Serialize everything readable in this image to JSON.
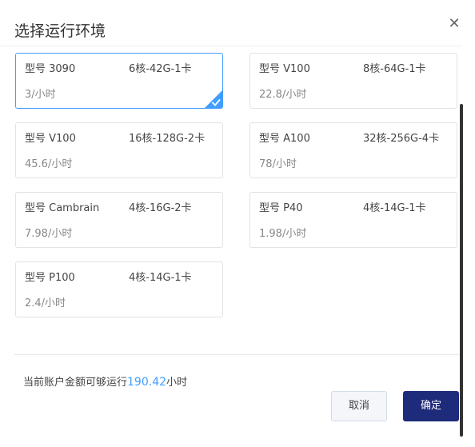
{
  "dialog": {
    "title": "选择运行环境",
    "close_icon": "close-icon"
  },
  "environments": [
    {
      "model": "型号 3090",
      "spec": "6核-42G-1卡",
      "price": "3/小时",
      "selected": true
    },
    {
      "model": "型号 V100",
      "spec": "8核-64G-1卡",
      "price": "22.8/小时",
      "selected": false
    },
    {
      "model": "型号 V100",
      "spec": "16核-128G-2卡",
      "price": "45.6/小时",
      "selected": false
    },
    {
      "model": "型号 A100",
      "spec": "32核-256G-4卡",
      "price": "78/小时",
      "selected": false
    },
    {
      "model": "型号 Cambrain",
      "spec": "4核-16G-2卡",
      "price": "7.98/小时",
      "selected": false
    },
    {
      "model": "型号 P40",
      "spec": "4核-14G-1卡",
      "price": "1.98/小时",
      "selected": false
    },
    {
      "model": "型号 P100",
      "spec": "4核-14G-1卡",
      "price": "2.4/小时",
      "selected": false
    }
  ],
  "footer": {
    "balance_prefix": "当前账户金额可够运行",
    "balance_amount": "190.42",
    "balance_suffix": "小时",
    "cancel_label": "取消",
    "confirm_label": "确定"
  },
  "colors": {
    "accent": "#409eff",
    "primary_button": "#1e2a7a",
    "border": "#e3e3e3"
  }
}
